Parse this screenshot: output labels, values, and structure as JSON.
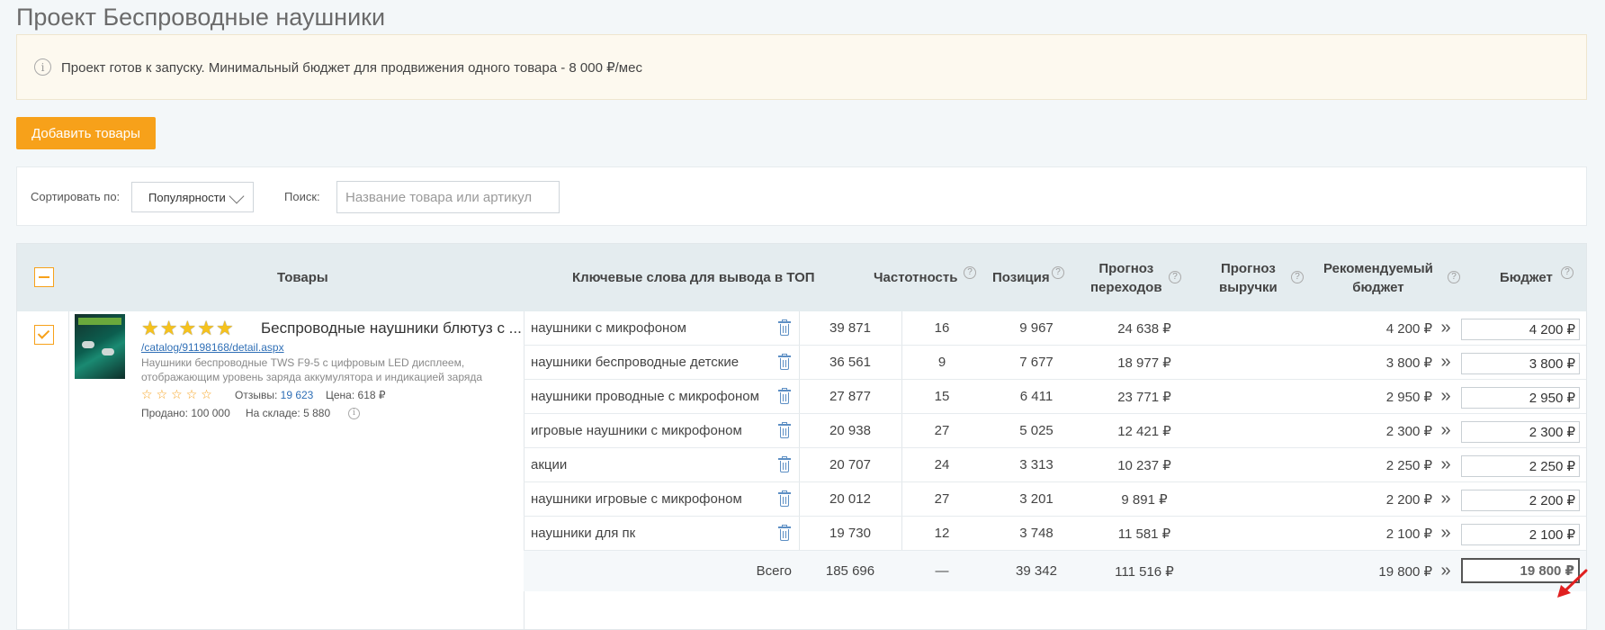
{
  "page_title": "Проект Беспроводные наушники",
  "notice": {
    "icon": "info-icon",
    "text": "Проект готов к запуску. Минимальный бюджет для продвижения одного товара - 8 000 ₽/мес"
  },
  "add_button_label": "Добавить товары",
  "filters": {
    "sort_label": "Сортировать по:",
    "sort_value": "Популярности",
    "search_label": "Поиск:",
    "search_placeholder": "Название товара или артикул"
  },
  "columns": {
    "products": "Товары",
    "keywords": "Ключевые слова для вывода в ТОП",
    "frequency": "Частотность",
    "position": "Позиция",
    "clicks_forecast_1": "Прогноз",
    "clicks_forecast_2": "переходов",
    "revenue_forecast_1": "Прогноз",
    "revenue_forecast_2": "выручки",
    "recommended_1": "Рекомендуемый",
    "recommended_2": "бюджет",
    "budget": "Бюджет",
    "help_glyph": "?"
  },
  "product": {
    "rating_stars": 5,
    "title": "Беспроводные наушники блютуз с ...",
    "link": "/catalog/91198168/detail.aspx",
    "description": "Наушники беспроводные TWS F9-5 с цифровым LED дисплеем, отображающим уровень заряда аккумулятора и индикацией заряда",
    "small_stars": 5,
    "reviews_label": "Отзывы:",
    "reviews_value": "19 623",
    "price_label": "Цена:",
    "price_value": "618 ₽",
    "sold_label": "Продано:",
    "sold_value": "100 000",
    "stock_label": "На складе:",
    "stock_value": "5 880"
  },
  "rows": [
    {
      "keyword": "наушники с микрофоном",
      "frequency": "39 871",
      "position": "16",
      "clicks": "9 967",
      "revenue": "24 638 ₽",
      "recommended": "4 200 ₽",
      "budget": "4 200 ₽"
    },
    {
      "keyword": "наушники беспроводные детские",
      "frequency": "36 561",
      "position": "9",
      "clicks": "7 677",
      "revenue": "18 977 ₽",
      "recommended": "3 800 ₽",
      "budget": "3 800 ₽"
    },
    {
      "keyword": "наушники проводные с микрофоном",
      "frequency": "27 877",
      "position": "15",
      "clicks": "6 411",
      "revenue": "23 771 ₽",
      "recommended": "2 950 ₽",
      "budget": "2 950 ₽"
    },
    {
      "keyword": "игровые наушники с микрофоном",
      "frequency": "20 938",
      "position": "27",
      "clicks": "5 025",
      "revenue": "12 421 ₽",
      "recommended": "2 300 ₽",
      "budget": "2 300 ₽"
    },
    {
      "keyword": "акции",
      "frequency": "20 707",
      "position": "24",
      "clicks": "3 313",
      "revenue": "10 237 ₽",
      "recommended": "2 250 ₽",
      "budget": "2 250 ₽"
    },
    {
      "keyword": "наушники игровые с микрофоном",
      "frequency": "20 012",
      "position": "27",
      "clicks": "3 201",
      "revenue": "9 891 ₽",
      "recommended": "2 200 ₽",
      "budget": "2 200 ₽"
    },
    {
      "keyword": "наушники для пк",
      "frequency": "19 730",
      "position": "12",
      "clicks": "3 748",
      "revenue": "11 581 ₽",
      "recommended": "2 100 ₽",
      "budget": "2 100 ₽"
    }
  ],
  "total": {
    "label": "Всего",
    "frequency": "185 696",
    "position": "—",
    "clicks": "39 342",
    "revenue": "111 516 ₽",
    "recommended": "19 800 ₽",
    "budget": "19 800 ₽"
  },
  "glyphs": {
    "star": "★",
    "star_outline": "☆",
    "arrow": "»",
    "info": "i"
  },
  "colors": {
    "accent": "#f7a11a",
    "link": "#2f6fb6",
    "header_bg": "#e4ecef",
    "notice_bg": "#fdf9ef",
    "annotation": "#e02020"
  }
}
